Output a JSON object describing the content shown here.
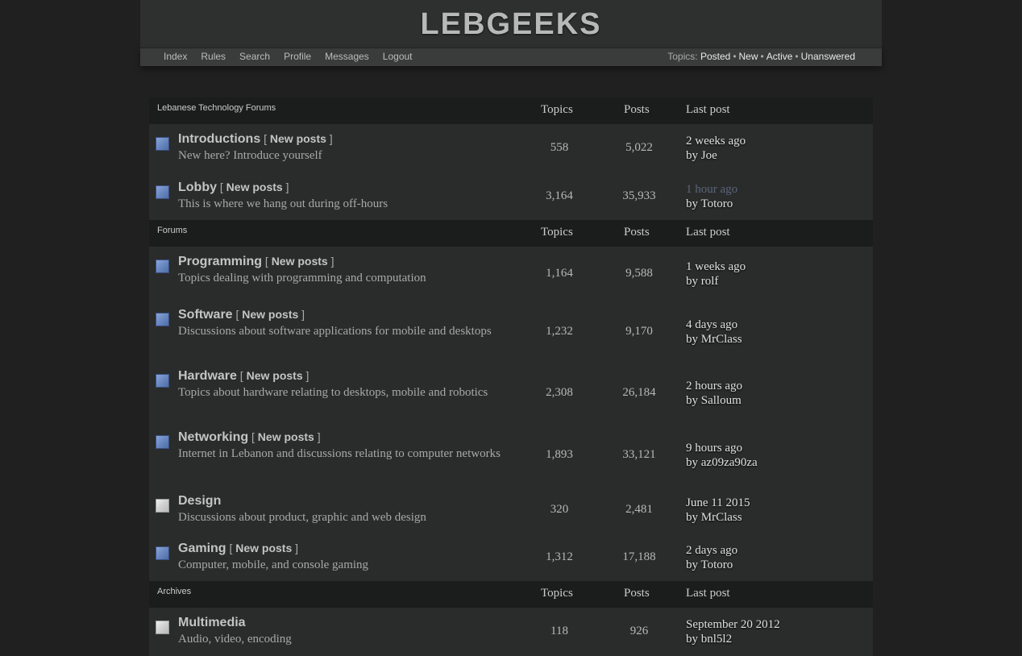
{
  "site": {
    "title": "LEBGEEKS"
  },
  "nav": {
    "links": [
      "Index",
      "Rules",
      "Search",
      "Profile",
      "Messages",
      "Logout"
    ],
    "topics_label": "Topics:",
    "topic_links": [
      "Posted",
      "New",
      "Active",
      "Unanswered"
    ]
  },
  "columns": {
    "topics": "Topics",
    "posts": "Posts",
    "last_post": "Last post"
  },
  "new_posts_label": "New posts",
  "categories": [
    {
      "title": "Lebanese Technology Forums",
      "forums": [
        {
          "name": "Introductions",
          "has_new": true,
          "desc": "New here? Introduce yourself",
          "topics": "558",
          "posts": "5,022",
          "last_when": "2 weeks ago",
          "last_by": "by Joe"
        },
        {
          "name": "Lobby",
          "has_new": true,
          "desc": "This is where we hang out during off-hours",
          "topics": "3,164",
          "posts": "35,933",
          "last_when": "1 hour ago",
          "last_by": "by Totoro"
        }
      ]
    },
    {
      "title": "Forums",
      "forums": [
        {
          "name": "Programming",
          "has_new": true,
          "desc": "Topics dealing with programming and computation",
          "topics": "1,164",
          "posts": "9,588",
          "last_when": "1 weeks ago",
          "last_by": "by rolf"
        },
        {
          "name": "Software",
          "has_new": true,
          "desc": "Discussions about software applications for mobile and desktops",
          "topics": "1,232",
          "posts": "9,170",
          "last_when": "4 days ago",
          "last_by": "by MrClass"
        },
        {
          "name": "Hardware",
          "has_new": true,
          "desc": "Topics about hardware relating to desktops, mobile and robotics",
          "topics": "2,308",
          "posts": "26,184",
          "last_when": "2 hours ago",
          "last_by": "by Salloum"
        },
        {
          "name": "Networking",
          "has_new": true,
          "desc": "Internet in Lebanon and discussions relating to computer networks",
          "topics": "1,893",
          "posts": "33,121",
          "last_when": "9 hours ago",
          "last_by": "by az09za90za"
        },
        {
          "name": "Design",
          "has_new": false,
          "desc": "Discussions about product, graphic and web design",
          "topics": "320",
          "posts": "2,481",
          "last_when": "June 11 2015",
          "last_by": "by MrClass"
        },
        {
          "name": "Gaming",
          "has_new": true,
          "desc": "Computer, mobile, and console gaming",
          "topics": "1,312",
          "posts": "17,188",
          "last_when": "2 days ago",
          "last_by": "by Totoro"
        }
      ]
    },
    {
      "title": "Archives",
      "forums": [
        {
          "name": "Multimedia",
          "has_new": false,
          "desc": "Audio, video, encoding",
          "topics": "118",
          "posts": "926",
          "last_when": "September 20 2012",
          "last_by": "by bnl5l2"
        }
      ]
    }
  ]
}
